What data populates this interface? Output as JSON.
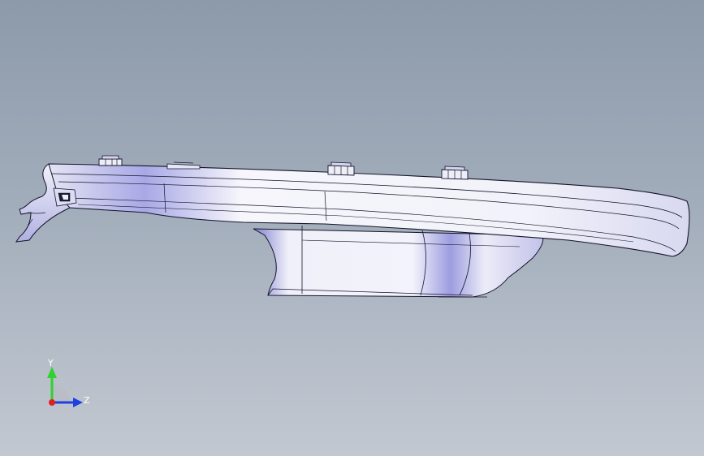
{
  "viewport": {
    "background_top": "#8c9aaa",
    "background_bottom": "#c2c8d1"
  },
  "model": {
    "fill_light": "#f4f4fb",
    "fill_shade": "#8c8cd8",
    "edge": "#14142a"
  },
  "triad": {
    "y_label": "Y",
    "z_label": "Z",
    "y_color": "#2fd12f",
    "z_color": "#1f3fe0",
    "x_color": "#e02020"
  }
}
